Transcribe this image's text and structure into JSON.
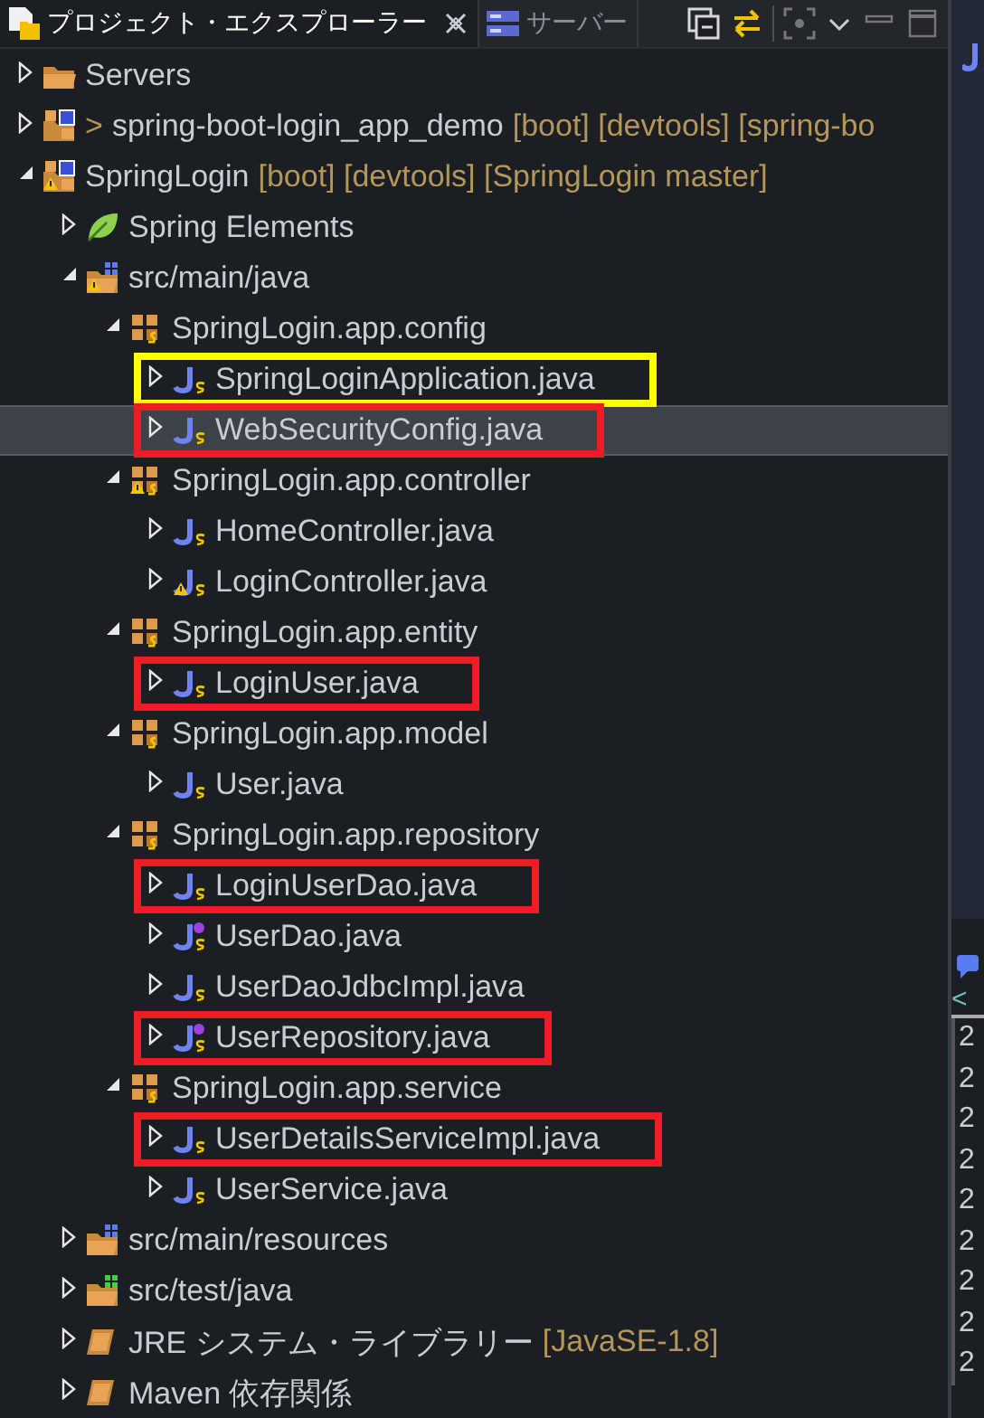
{
  "tabs": [
    {
      "label": "プロジェクト・エクスプローラー",
      "selected": true,
      "closable": true,
      "kind": "explorer"
    },
    {
      "label": "サーバー",
      "selected": false,
      "closable": false,
      "kind": "server"
    }
  ],
  "tree": [
    {
      "label": "Servers",
      "kind": "folder",
      "expanded": false,
      "warning": false,
      "selected": false
    },
    {
      "prefix": ">",
      "label": "spring-boot-login_app_demo",
      "decoration": "[boot] [devtools] [spring-bo",
      "kind": "project",
      "expanded": false,
      "warning": false,
      "selected": false
    },
    {
      "label": "SpringLogin",
      "decoration": "[boot] [devtools] [SpringLogin master]",
      "kind": "project",
      "expanded": true,
      "warning": true,
      "selected": false,
      "children": [
        {
          "label": "Spring Elements",
          "kind": "spring",
          "expanded": false,
          "warning": false,
          "selected": false
        },
        {
          "label": "src/main/java",
          "kind": "srcfolder",
          "expanded": true,
          "warning": true,
          "selected": false,
          "children": [
            {
              "label": "SpringLogin.app.config",
              "kind": "package",
              "expanded": true,
              "warning": false,
              "selected": false,
              "children": [
                {
                  "label": "SpringLoginApplication.java",
                  "kind": "java",
                  "expanded": false,
                  "warning": false,
                  "selected": false,
                  "color": "#ffff00"
                },
                {
                  "label": "WebSecurityConfig.java",
                  "kind": "java",
                  "expanded": false,
                  "warning": false,
                  "selected": true,
                  "color": "#ee1c25"
                }
              ]
            },
            {
              "label": "SpringLogin.app.controller",
              "kind": "package",
              "expanded": true,
              "warning": true,
              "selected": false,
              "children": [
                {
                  "label": "HomeController.java",
                  "kind": "java",
                  "expanded": false,
                  "warning": false,
                  "selected": false
                },
                {
                  "label": "LoginController.java",
                  "kind": "java",
                  "expanded": false,
                  "warning": true,
                  "selected": false
                }
              ]
            },
            {
              "label": "SpringLogin.app.entity",
              "kind": "package",
              "expanded": true,
              "warning": false,
              "selected": false,
              "children": [
                {
                  "label": "LoginUser.java",
                  "kind": "java",
                  "expanded": false,
                  "warning": false,
                  "selected": false,
                  "color": "#ee1c25"
                }
              ]
            },
            {
              "label": "SpringLogin.app.model",
              "kind": "package",
              "expanded": true,
              "warning": false,
              "selected": false,
              "children": [
                {
                  "label": "User.java",
                  "kind": "java",
                  "expanded": false,
                  "warning": false,
                  "selected": false
                }
              ]
            },
            {
              "label": "SpringLogin.app.repository",
              "kind": "package",
              "expanded": true,
              "warning": false,
              "selected": false,
              "children": [
                {
                  "label": "LoginUserDao.java",
                  "kind": "java",
                  "expanded": false,
                  "warning": false,
                  "selected": false,
                  "color": "#ee1c25"
                },
                {
                  "label": "UserDao.java",
                  "kind": "interface",
                  "expanded": false,
                  "warning": false,
                  "selected": false
                },
                {
                  "label": "UserDaoJdbcImpl.java",
                  "kind": "java",
                  "expanded": false,
                  "warning": false,
                  "selected": false
                },
                {
                  "label": "UserRepository.java",
                  "kind": "interface",
                  "expanded": false,
                  "warning": false,
                  "selected": false,
                  "color": "#ee1c25"
                }
              ]
            },
            {
              "label": "SpringLogin.app.service",
              "kind": "package",
              "expanded": true,
              "warning": false,
              "selected": false,
              "children": [
                {
                  "label": "UserDetailsServiceImpl.java",
                  "kind": "java",
                  "expanded": false,
                  "warning": false,
                  "selected": false,
                  "color": "#ee1c25"
                },
                {
                  "label": "UserService.java",
                  "kind": "java",
                  "expanded": false,
                  "warning": false,
                  "selected": false
                }
              ]
            }
          ]
        },
        {
          "label": "src/main/resources",
          "kind": "srcfolder",
          "expanded": false,
          "warning": false,
          "selected": false
        },
        {
          "label": "src/test/java",
          "kind": "testfolder",
          "expanded": false,
          "warning": false,
          "selected": false
        },
        {
          "label": "JRE システム・ライブラリー",
          "decoration": "[JavaSE-1.8]",
          "kind": "library",
          "expanded": false,
          "warning": false,
          "selected": false
        },
        {
          "label": "Maven 依存関係",
          "kind": "library",
          "expanded": false,
          "warning": false,
          "selected": false
        }
      ]
    }
  ],
  "side_panel": {
    "header": "<",
    "lines": [
      "2",
      "2",
      "2",
      "2",
      "2",
      "2",
      "2",
      "2",
      "2"
    ]
  }
}
